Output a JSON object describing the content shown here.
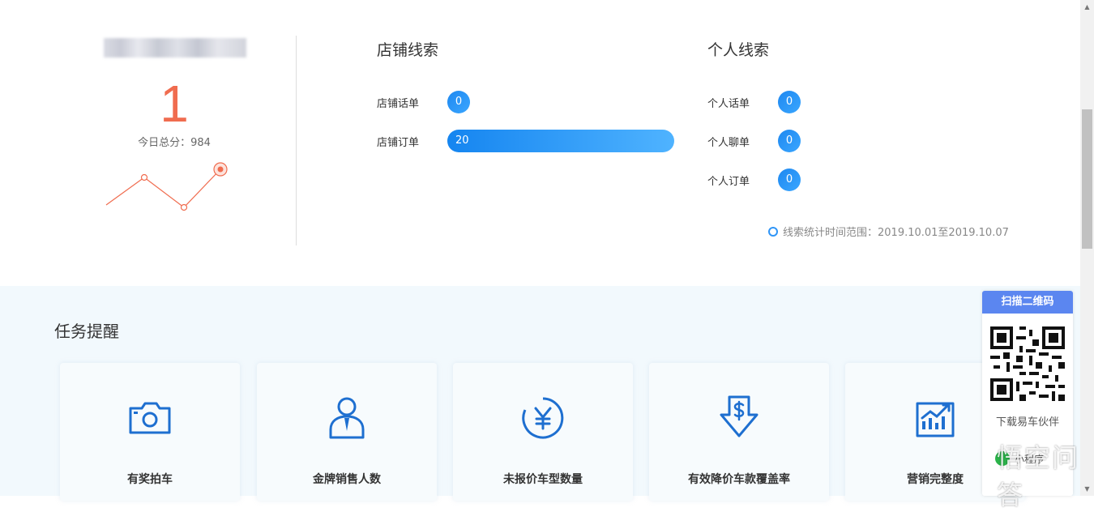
{
  "score": {
    "value": "1",
    "today_total": "今日总分：984"
  },
  "store_leads": {
    "title": "店铺线索",
    "rows": [
      {
        "label": "店铺话单",
        "value": "0"
      },
      {
        "label": "店铺订单",
        "value": "20"
      }
    ]
  },
  "personal_leads": {
    "title": "个人线索",
    "rows": [
      {
        "label": "个人话单",
        "value": "0"
      },
      {
        "label": "个人聊单",
        "value": "0"
      },
      {
        "label": "个人订单",
        "value": "0"
      }
    ]
  },
  "stat_range": "线索统计时间范围：2019.10.01至2019.10.07",
  "tasks": {
    "title": "任务提醒",
    "cards": [
      {
        "label": "有奖拍车",
        "icon": "camera-icon"
      },
      {
        "label": "金牌销售人数",
        "icon": "salesperson-icon"
      },
      {
        "label": "未报价车型数量",
        "icon": "yuan-icon"
      },
      {
        "label": "有效降价车款覆盖率",
        "icon": "price-drop-icon"
      },
      {
        "label": "营销完整度",
        "icon": "chart-up-icon"
      }
    ]
  },
  "qr": {
    "header": "扫描二维码",
    "caption": "下载易车伙伴",
    "mini_program": "小程序"
  },
  "watermark": "悟空问答",
  "colors": {
    "accent": "#1e88f0",
    "score": "#f06c4f",
    "qr_header": "#5b86f0"
  }
}
